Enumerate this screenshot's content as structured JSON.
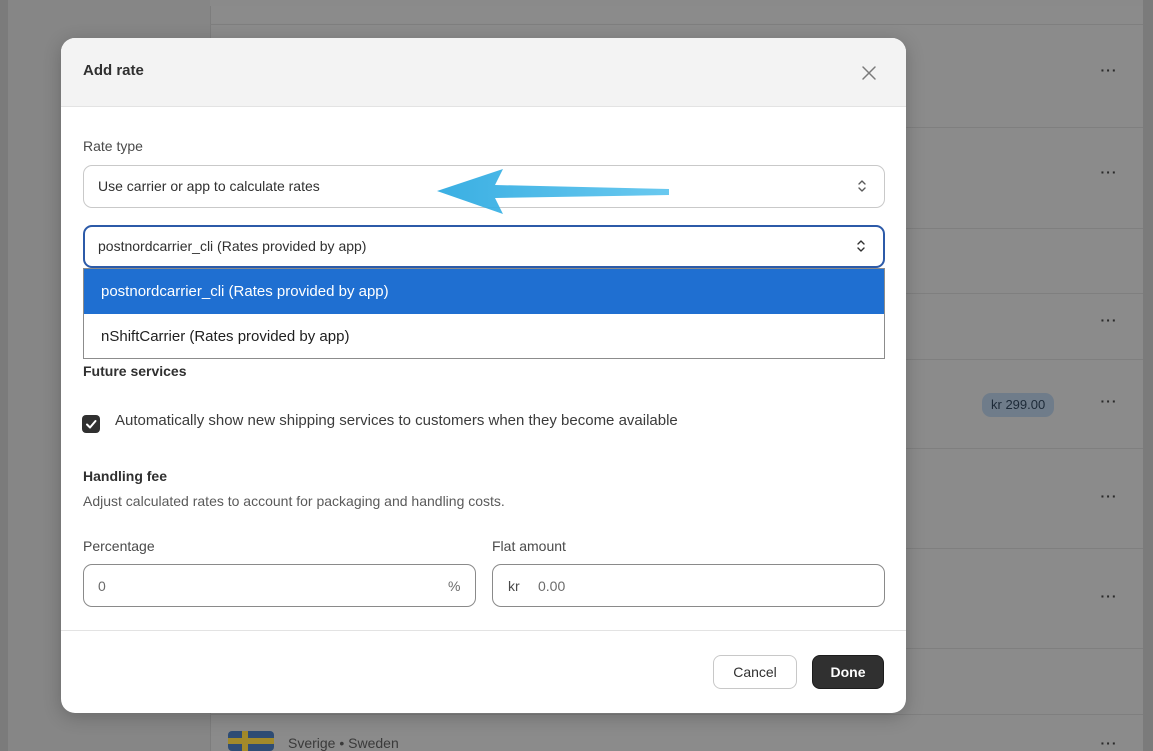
{
  "background": {
    "badge": "kr 299.00",
    "country": "Sverige • Sweden",
    "row_menu": "···"
  },
  "modal": {
    "title": "Add rate",
    "rate_type_label": "Rate type",
    "rate_type_value": "Use carrier or app to calculate rates",
    "carrier_value": "postnordcarrier_cli (Rates provided by app)",
    "carrier_options": [
      {
        "label": "postnordcarrier_cli (Rates provided by app)",
        "selected": true
      },
      {
        "label": "nShiftCarrier (Rates provided by app)",
        "selected": false
      }
    ],
    "future_services_heading": "Future services",
    "auto_show_label": "Automatically show new shipping services to customers when they become available",
    "auto_show_checked": true,
    "handling_fee_heading": "Handling fee",
    "handling_fee_desc": "Adjust calculated rates to account for packaging and handling costs.",
    "percentage_label": "Percentage",
    "percentage_value": "0",
    "percentage_suffix": "%",
    "flat_amount_label": "Flat amount",
    "flat_amount_prefix": "kr",
    "flat_amount_placeholder": "0.00",
    "cancel_label": "Cancel",
    "done_label": "Done"
  },
  "colors": {
    "accent": "#1f6fd1",
    "annotation_arrow": "#29a8e0",
    "primary_button": "#303030"
  },
  "icons": {
    "close": "close-icon",
    "select_chevrons": "chevron-updown-icon",
    "checkbox": "checkmark-icon",
    "annotation": "arrow-left-icon"
  }
}
